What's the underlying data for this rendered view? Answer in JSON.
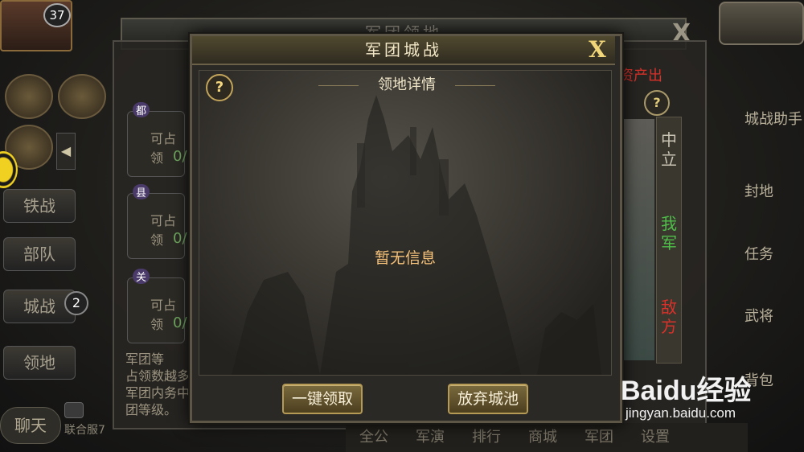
{
  "hud": {
    "level": "37",
    "under_title": "军团领地",
    "under_close": "X"
  },
  "left_menu": {
    "items": [
      "铁战",
      "部队",
      "城战",
      "领地"
    ],
    "badge": "2",
    "chat": "聊天",
    "server_text": "联合服7"
  },
  "under_panel": {
    "resource_label": "资产出",
    "help": "?",
    "cards": [
      {
        "tag": "都",
        "title": "可占领",
        "count": "0/"
      },
      {
        "tag": "县",
        "title": "可占领",
        "count": "0/"
      },
      {
        "tag": "关",
        "title": "可占领",
        "count": "0/"
      }
    ],
    "desc_lines": [
      "军团等",
      "占领数越多",
      "军团内务中",
      "团等级。"
    ],
    "legend": {
      "neutral": "中立",
      "ours": "我军",
      "enemy": "敌方"
    }
  },
  "right_menu": [
    "城战助手",
    "封地",
    "任务",
    "武将",
    "背包"
  ],
  "bottom_bar": [
    "全公",
    "军演",
    "排行",
    "商城",
    "军团",
    "设置"
  ],
  "modal": {
    "title": "军团城战",
    "close_label": "X",
    "help": "?",
    "section_title": "领地详情",
    "empty_message": "暂无信息",
    "buttons": {
      "claim_all": "一键领取",
      "abandon_city": "放弃城池"
    }
  },
  "watermark": {
    "logo": "Baidu经验",
    "url": "jingyan.baidu.com"
  },
  "colors": {
    "accent_gold": "#f2d77a",
    "empty_text": "#f6c27a",
    "enemy_red": "#d8322a",
    "ours_green": "#4fbf4a"
  }
}
